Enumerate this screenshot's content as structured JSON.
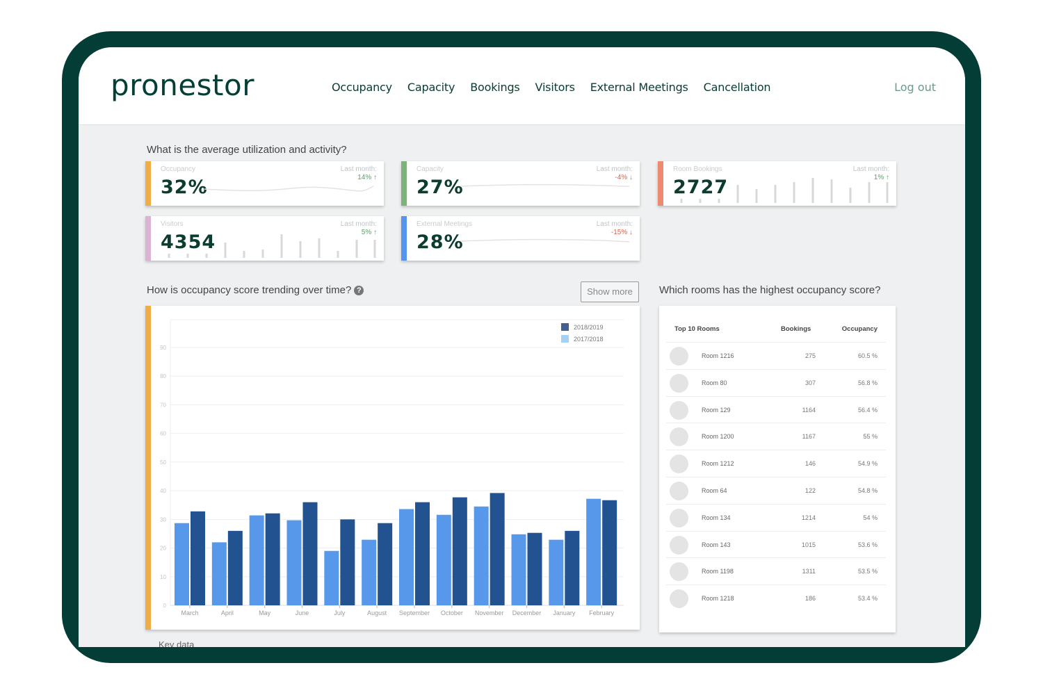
{
  "app": {
    "logo": "pronestor",
    "nav": [
      "Occupancy",
      "Capacity",
      "Bookings",
      "Visitors",
      "External Meetings",
      "Cancellation"
    ],
    "logout": "Log out"
  },
  "colors": {
    "frame": "#033d36",
    "occupancy_accent": "#f0ad45",
    "capacity_accent": "#7fb17a",
    "bookings_accent": "#ef8a6e",
    "visitors_accent": "#dcb3d2",
    "external_accent": "#5595ee",
    "series_2018_2019": "#22528f",
    "series_2017_2018": "#5898eb",
    "trend_up": "#5aa066",
    "trend_down": "#e0604a"
  },
  "kpi_section": {
    "title": "What is the average utilization and activity?",
    "cards": [
      {
        "label": "Occupancy",
        "value": "32%",
        "last_month_label": "Last month:",
        "last_month_value": "14%",
        "trend": "up",
        "trend_icon": "↑",
        "spark": "line"
      },
      {
        "label": "Capacity",
        "value": "27%",
        "last_month_label": "Last month:",
        "last_month_value": "-4%",
        "trend": "down",
        "trend_icon": "↓",
        "spark": "line"
      },
      {
        "label": "Room Bookings",
        "value": "2727",
        "last_month_label": "Last month:",
        "last_month_value": "1%",
        "trend": "up",
        "trend_icon": "↑",
        "spark": "bars"
      },
      {
        "label": "Visitors",
        "value": "4354",
        "last_month_label": "Last month:",
        "last_month_value": "5%",
        "trend": "up",
        "trend_icon": "↑",
        "spark": "bars"
      },
      {
        "label": "External Meetings",
        "value": "28%",
        "last_month_label": "Last month:",
        "last_month_value": "-15%",
        "trend": "down",
        "trend_icon": "↓",
        "spark": "line"
      }
    ]
  },
  "trend_section": {
    "title": "How is occupancy score trending over time?",
    "help_icon": "?",
    "show_more": "Show more"
  },
  "chart_data": {
    "type": "bar",
    "title": "How is occupancy score trending over time?",
    "xlabel": "",
    "ylabel": "",
    "ylim": [
      0,
      90
    ],
    "yticks": [
      0,
      10,
      20,
      30,
      40,
      50,
      60,
      70,
      80,
      90
    ],
    "grid": true,
    "legend_position": "top-right",
    "categories": [
      "March",
      "April",
      "May",
      "June",
      "July",
      "August",
      "September",
      "October",
      "November",
      "December",
      "January",
      "February"
    ],
    "series": [
      {
        "name": "2017/2018",
        "values": [
          28.7,
          22,
          31.4,
          29.7,
          19,
          22.9,
          33.6,
          31.6,
          34.5,
          24.8,
          22.9,
          37.2
        ]
      },
      {
        "name": "2018/2019",
        "values": [
          32.8,
          26,
          32.1,
          36,
          30,
          28.7,
          36,
          37.7,
          39.2,
          25.3,
          26,
          36.7
        ]
      }
    ],
    "legend": [
      "2018/2019",
      "2017/2018"
    ]
  },
  "rooms_section": {
    "title": "Which rooms has the highest occupancy score?",
    "headers": [
      "Top 10 Rooms",
      "Bookings",
      "Occupancy"
    ],
    "rows": [
      {
        "room": "Room 1216",
        "bookings": "275",
        "occupancy": "60.5 %"
      },
      {
        "room": "Room 80",
        "bookings": "307",
        "occupancy": "56.8 %"
      },
      {
        "room": "Room 129",
        "bookings": "1164",
        "occupancy": "56.4 %"
      },
      {
        "room": "Room 1200",
        "bookings": "1167",
        "occupancy": "55 %"
      },
      {
        "room": "Room 1212",
        "bookings": "146",
        "occupancy": "54.9 %"
      },
      {
        "room": "Room 64",
        "bookings": "122",
        "occupancy": "54.8 %"
      },
      {
        "room": "Room 134",
        "bookings": "1214",
        "occupancy": "54 %"
      },
      {
        "room": "Room 143",
        "bookings": "1015",
        "occupancy": "53.6 %"
      },
      {
        "room": "Room 1198",
        "bookings": "1311",
        "occupancy": "53.5 %"
      },
      {
        "room": "Room 1218",
        "bookings": "186",
        "occupancy": "53.4 %"
      }
    ]
  },
  "key_data": {
    "title": "Key data"
  }
}
